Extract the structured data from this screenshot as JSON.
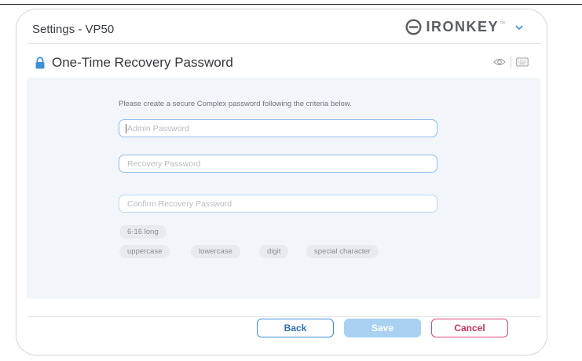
{
  "window": {
    "title": "Settings - VP50",
    "brand": {
      "name": "IRONKEY",
      "trademark": "™"
    }
  },
  "page": {
    "heading": "One-Time Recovery Password",
    "instruction": "Please create a secure Complex password following the criteria below."
  },
  "fields": {
    "admin_password": {
      "placeholder": "Admin Password",
      "value": ""
    },
    "recovery_password": {
      "placeholder": "Recovery Password",
      "value": ""
    },
    "confirm_recovery_password": {
      "placeholder": "Confirm Recovery Password",
      "value": ""
    }
  },
  "criteria": {
    "length": "6-16 long",
    "uppercase": "uppercase",
    "lowercase": "lowercase",
    "digit": "digit",
    "special": "special character"
  },
  "buttons": {
    "back": "Back",
    "save": "Save",
    "cancel": "Cancel"
  },
  "icons": {
    "brand_logo": "ironkey-logo-icon",
    "menu": "chevron-down-icon",
    "heading": "lock-icon",
    "show_password": "eye-icon",
    "virtual_keyboard": "keyboard-icon"
  },
  "colors": {
    "accent": "#3f8fd6",
    "save_disabled": "#a9d2f2",
    "cancel": "#e0457a",
    "lock": "#3f8fd6",
    "panel": "#f2f6fb"
  }
}
